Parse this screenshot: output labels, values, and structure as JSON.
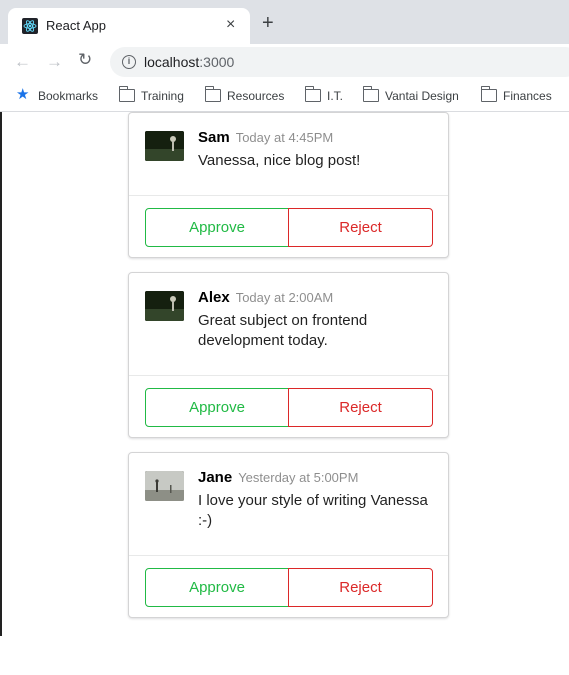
{
  "browser": {
    "tab_title": "React App",
    "tab_close": "×",
    "new_tab": "+",
    "nav_back": "←",
    "nav_forward": "→",
    "nav_reload": "↻",
    "url_host": "localhost",
    "url_port": ":3000"
  },
  "bookmarks": [
    {
      "label": "Bookmarks",
      "icon": "star-icon"
    },
    {
      "label": "Training",
      "icon": "folder-icon"
    },
    {
      "label": "Resources",
      "icon": "folder-icon"
    },
    {
      "label": "I.T.",
      "icon": "folder-icon"
    },
    {
      "label": "Vantai Design",
      "icon": "folder-icon"
    },
    {
      "label": "Finances",
      "icon": "folder-icon"
    }
  ],
  "comments": [
    {
      "author": "Sam",
      "time": "Today at 4:45PM",
      "text": "Vanessa, nice blog post!",
      "approve_label": "Approve",
      "reject_label": "Reject"
    },
    {
      "author": "Alex",
      "time": "Today at 2:00AM",
      "text": "Great subject on frontend development today.",
      "approve_label": "Approve",
      "reject_label": "Reject"
    },
    {
      "author": "Jane",
      "time": "Yesterday at 5:00PM",
      "text": "I love your style of writing Vanessa :-)",
      "approve_label": "Approve",
      "reject_label": "Reject"
    }
  ],
  "colors": {
    "approve": "#21ba45",
    "reject": "#db2828",
    "accent": "#1a73e8"
  }
}
